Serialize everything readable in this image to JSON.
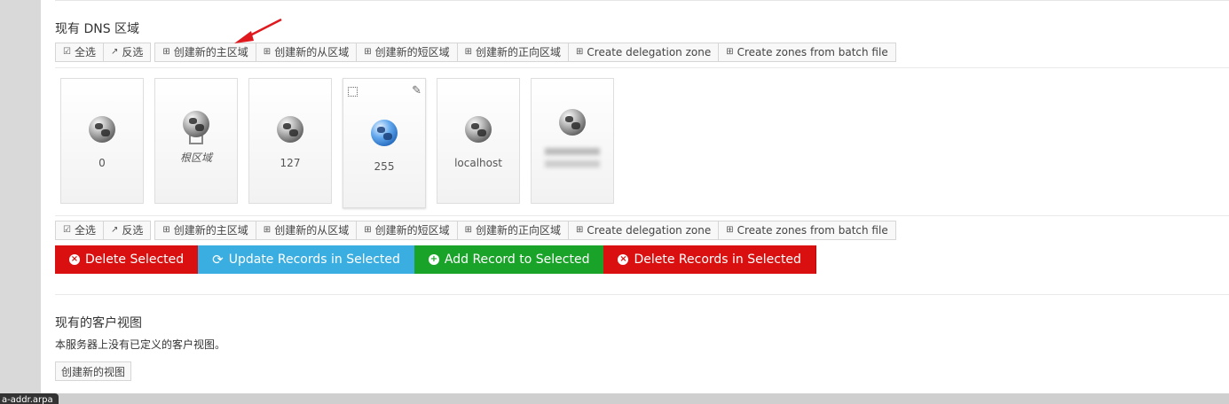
{
  "zones_section": {
    "title": "现有 DNS 区域",
    "toolbar": {
      "select_all": "全选",
      "invert": "反选",
      "create_master": "创建新的主区域",
      "create_slave": "创建新的从区域",
      "create_stub": "创建新的短区域",
      "create_forward": "创建新的正向区域",
      "create_delegation": "Create delegation zone",
      "create_batch": "Create zones from batch file"
    },
    "zones": [
      {
        "label": "0",
        "icon": "globe-gray"
      },
      {
        "label": "根区域",
        "icon": "globe-network"
      },
      {
        "label": "127",
        "icon": "globe-gray"
      },
      {
        "label": "255",
        "icon": "globe-blue"
      },
      {
        "label": "localhost",
        "icon": "globe-gray"
      },
      {
        "label": "",
        "icon": "globe-gray"
      }
    ],
    "actions": {
      "delete_selected": "Delete Selected",
      "update_records": "Update Records in Selected",
      "add_record": "Add Record to Selected",
      "delete_records": "Delete Records in Selected"
    },
    "colors": {
      "red": "#d9100f",
      "cyan": "#3aaee0",
      "green": "#1aa329",
      "arrow": "#e0191f"
    }
  },
  "views_section": {
    "title": "现有的客户视图",
    "description": "本服务器上没有已定义的客户视图。",
    "create_view": "创建新的视图"
  },
  "status_tooltip": "a-addr.arpa"
}
